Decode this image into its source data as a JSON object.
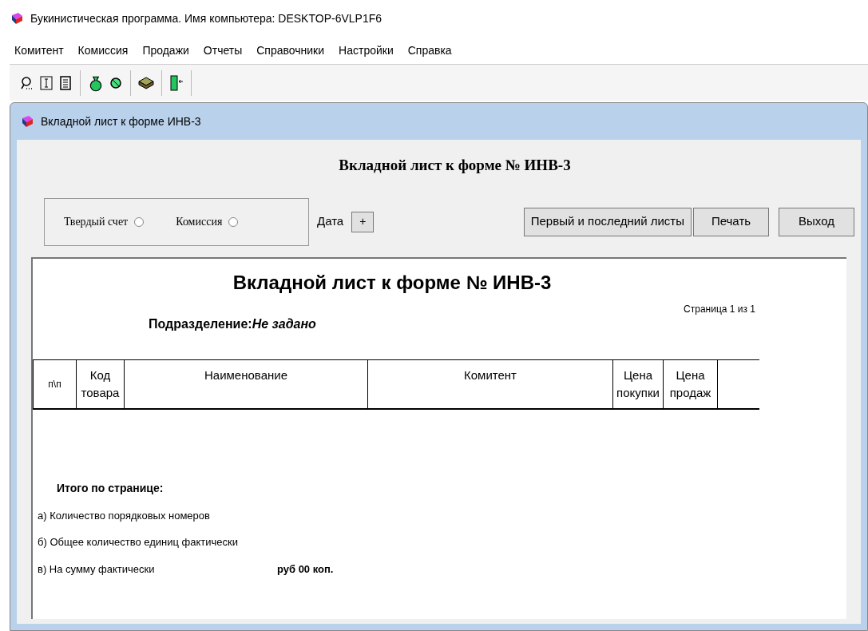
{
  "window": {
    "title": "Букинистическая программа. Имя компьютера: DESKTOP-6VLP1F6"
  },
  "menu": [
    "Комитент",
    "Комиссия",
    "Продажи",
    "Отчеты",
    "Справочники",
    "Настройки",
    "Справка"
  ],
  "child_window": {
    "title": "Вкладной лист к форме ИНВ-3"
  },
  "form": {
    "heading": "Вкладной лист к форме № ИНВ-3",
    "radios": [
      {
        "label": "Твердый счет",
        "selected": false
      },
      {
        "label": "Комиссия",
        "selected": false
      }
    ],
    "date_label": "Дата",
    "date_button": "+",
    "buttons": [
      "Первый и последний листы",
      "Печать",
      "Выход"
    ]
  },
  "report": {
    "title": "Вкладной лист к форме № ИНВ-3",
    "page": "Страница 1 из 1",
    "division_label": "Подразделение:",
    "division_value": "Не задано",
    "columns": [
      [
        "п\\п"
      ],
      [
        "Код",
        "товара"
      ],
      [
        "Наименование"
      ],
      [
        "Комитент"
      ],
      [
        "Цена",
        "покупки"
      ],
      [
        "Цена",
        "продаж"
      ]
    ],
    "totals_heading": "Итого по странице:",
    "totals": [
      {
        "label": "а) Количество порядковых номеров"
      },
      {
        "label": "б) Общее количество единиц фактически"
      },
      {
        "label": "в) На сумму фактически",
        "value": "руб 00 коп."
      }
    ]
  }
}
